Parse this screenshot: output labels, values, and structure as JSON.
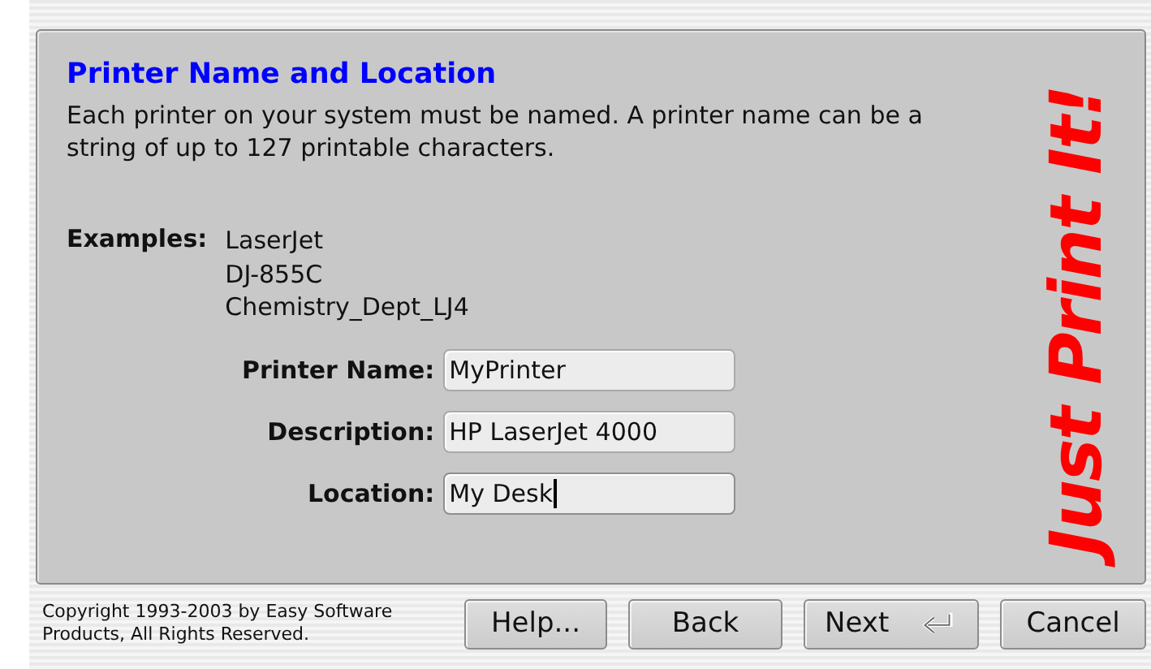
{
  "page": {
    "title": "Printer Name and Location",
    "intro": "Each printer on your system must be named. A printer name can be a string of up to 127 printable characters.",
    "examples_label": "Examples:",
    "examples": [
      "LaserJet",
      "DJ-855C",
      "Chemistry_Dept_LJ4"
    ],
    "fields": [
      {
        "label": "Printer Name:",
        "value": "MyPrinter",
        "focused": false
      },
      {
        "label": "Description:",
        "value": "HP LaserJet 4000",
        "focused": false
      },
      {
        "label": "Location:",
        "value": "My Desk",
        "focused": true
      }
    ],
    "logo": "Just Print It!"
  },
  "footer": {
    "copyright": "Copyright 1993-2003 by Easy Software Products, All Rights Reserved.",
    "buttons": [
      {
        "label": "Help...",
        "default": false
      },
      {
        "label": "Back",
        "default": false
      },
      {
        "label": "Next",
        "default": true
      },
      {
        "label": "Cancel",
        "default": false
      }
    ]
  }
}
